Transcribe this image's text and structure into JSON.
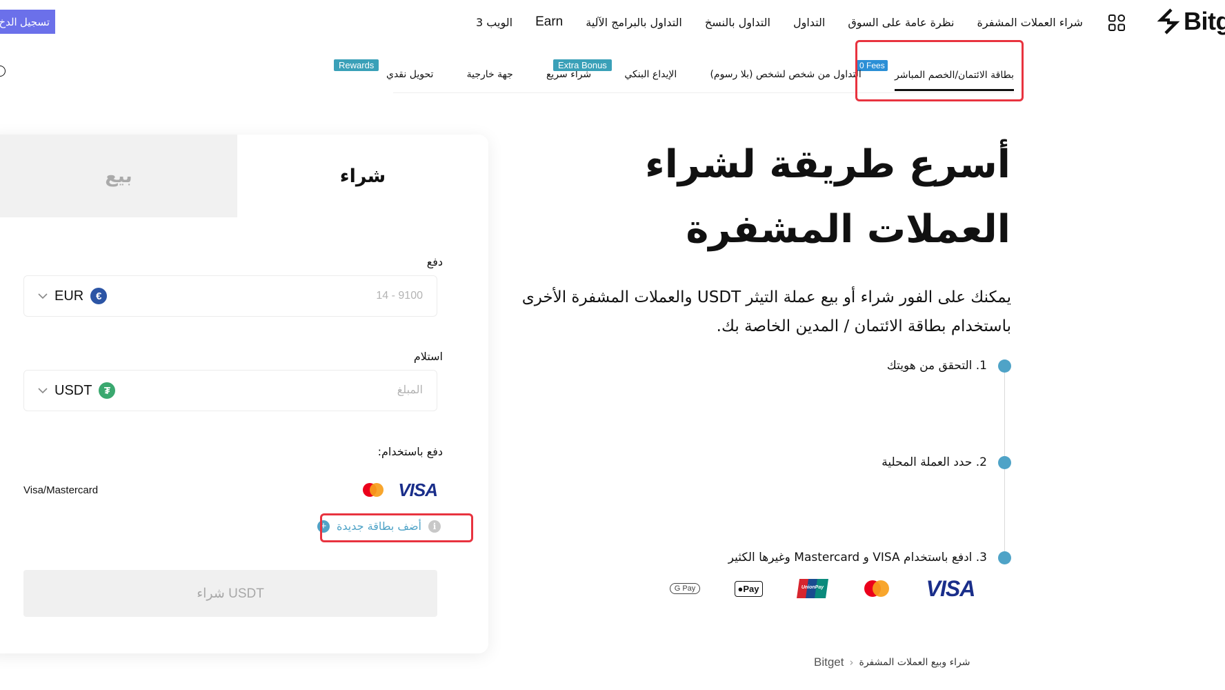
{
  "header": {
    "brand": "Bitg",
    "nav": [
      "شراء العملات المشفرة",
      "نظرة عامة على السوق",
      "التداول",
      "التداول بالنسخ",
      "التداول بالبرامج الآلية",
      "Earn",
      "الويب 3"
    ],
    "login": "تسجيل الدخ"
  },
  "subnav": {
    "items": [
      {
        "label": "بطاقة الائتمان/الخصم المباشر",
        "badge": "0 Fees"
      },
      {
        "label": "التداول من شخص لشخص (بلا رسوم)",
        "badge": ""
      },
      {
        "label": "الإيداع البنكي",
        "badge": ""
      },
      {
        "label": "شراء سريع",
        "badge": "Extra Bonus"
      },
      {
        "label": "جهة خارجية",
        "badge": ""
      },
      {
        "label": "تحويل نقدي",
        "badge": "Rewards"
      }
    ]
  },
  "hero": {
    "title": "أسرع طريقة لشراء العملات المشفرة",
    "description": "يمكنك على الفور شراء أو بيع عملة التيثر USDT والعملات المشفرة الأخرى باستخدام بطاقة الائتمان / المدين الخاصة بك.",
    "steps": [
      "1. التحقق من هويتك",
      "2. حدد العملة المحلية",
      "3. ادفع باستخدام VISA و Mastercard وغيرها الكثير"
    ]
  },
  "payment_icons": [
    "gpay-icon",
    "applepay-icon",
    "unionpay-icon",
    "mastercard-icon",
    "visa-icon"
  ],
  "payment_text": {
    "gpay": "G Pay",
    "applepay": "Pay",
    "unionpay": "UnionPay",
    "visa": "VISA"
  },
  "breadcrumb": {
    "root": "Bitget",
    "separator": "‹",
    "current": "شراء وبيع العملات المشفرة"
  },
  "widget": {
    "tab_buy": "شراء",
    "tab_sell": "بيع",
    "pay_label": "دفع",
    "pay_currency": "EUR",
    "pay_coin_symbol": "€",
    "pay_placeholder": "14 - 9100",
    "receive_label": "استلام",
    "receive_currency": "USDT",
    "receive_coin_symbol": "₮",
    "receive_placeholder": "المبلغ",
    "method_label": "دفع باستخدام:",
    "method_name": "Visa/Mastercard",
    "add_card": "أضف بطاقة جديدة",
    "info_symbol": "i",
    "plus_symbol": "+",
    "buy_button": "شراء USDT"
  },
  "colors": {
    "accent": "#4fa3c7",
    "login_bg": "#6b70ea",
    "highlight": "#e8333f",
    "badge": "#3aa0b8"
  }
}
